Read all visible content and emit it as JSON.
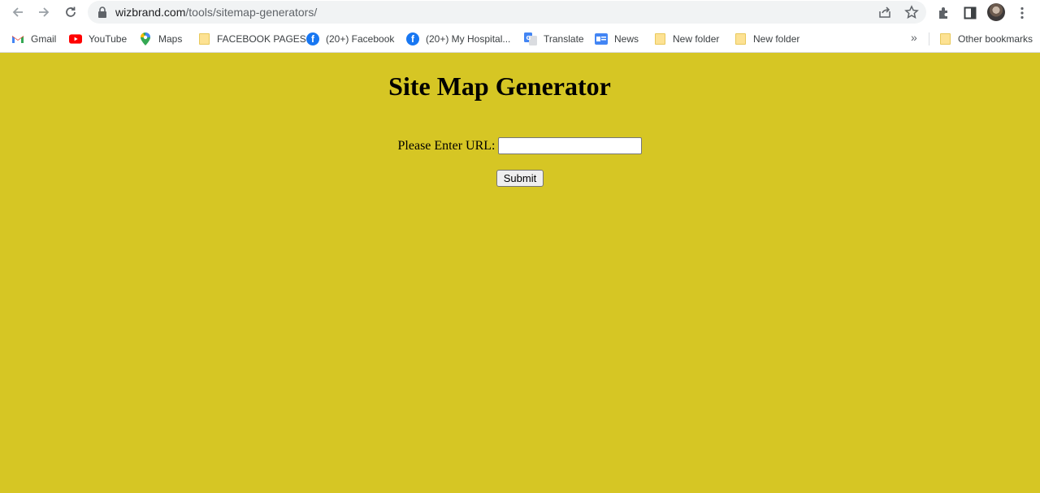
{
  "browser": {
    "url_domain": "wizbrand.com",
    "url_path": "/tools/sitemap-generators/"
  },
  "bookmarks": [
    {
      "label": "Gmail",
      "icon": "gmail-icon"
    },
    {
      "label": "YouTube",
      "icon": "youtube-icon"
    },
    {
      "label": "Maps",
      "icon": "maps-icon"
    },
    {
      "label": "FACEBOOK PAGES",
      "icon": "folder-icon"
    },
    {
      "label": "(20+) Facebook",
      "icon": "facebook-icon"
    },
    {
      "label": "(20+) My Hospital...",
      "icon": "facebook-icon"
    },
    {
      "label": "Translate",
      "icon": "translate-icon"
    },
    {
      "label": "News",
      "icon": "news-icon"
    },
    {
      "label": "New folder",
      "icon": "folder-icon"
    },
    {
      "label": "New folder",
      "icon": "folder-icon"
    }
  ],
  "other_bookmarks": "Other bookmarks",
  "overflow": "»",
  "page": {
    "title": "Site Map Generator",
    "url_label": "Please Enter URL:",
    "url_input_value": "",
    "submit_label": "Submit",
    "background_color": "#d6c624"
  }
}
